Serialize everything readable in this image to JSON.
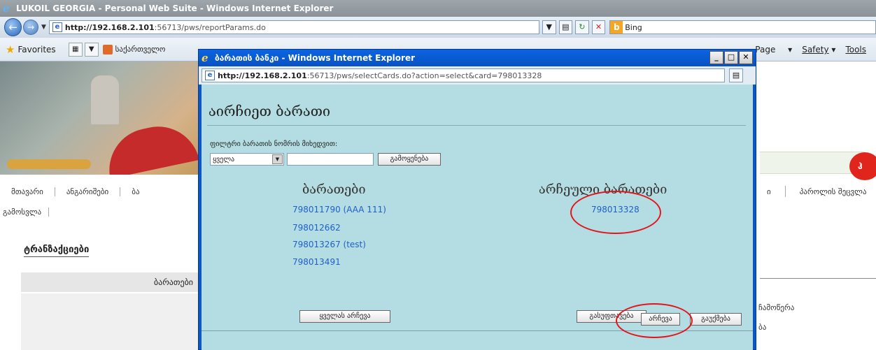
{
  "main_window": {
    "title": "LUKOIL GEORGIA - Personal Web Suite - Windows Internet Explorer",
    "url_host": "http://192.168.2.101",
    "url_rest": ":56713/pws/reportParams.do",
    "search_engine": "Bing",
    "favorites_label": "Favorites",
    "favorite_site": "საქართველო",
    "menu_page": "Page",
    "menu_safety": "Safety",
    "menu_tools": "Tools"
  },
  "page": {
    "nav_items": [
      "მთავარი",
      "ანგარიშები",
      "ბა"
    ],
    "nav_right_items": [
      "ი",
      "პაროლის შეცვლა"
    ],
    "logout": "გამოსვლა",
    "section_title": "ტრანზაქციები",
    "cards_column_header": "ბარათები",
    "right_text_1": "ჩამოწერა",
    "right_text_2": "ბა",
    "red_button_text": "ჰ"
  },
  "popup": {
    "title": "ბარათის ბანკი - Windows Internet Explorer",
    "url_host": "http://192.168.2.101",
    "url_rest": ":56713/pws/selectCards.do?action=select&card=798013328",
    "heading": "აირჩიეთ ბარათი",
    "filter_label": "ფილტრი ბარათის ნომრის მიხედვით:",
    "filter_select_value": "ყველა",
    "filter_input_value": "",
    "filter_button": "გამოყენება",
    "available_title": "ბარათები",
    "selected_title": "არჩეული ბარათები",
    "available_cards": [
      "798011790 (AAA 111)",
      "798012662",
      "798013267 (test)",
      "798013491"
    ],
    "selected_cards": [
      "798013328"
    ],
    "select_all_button": "ყველას არჩევა",
    "clear_button": "გასუფთავება",
    "ok_button": "არჩევა",
    "cancel_button": "გაუქმება"
  },
  "colors": {
    "popup_frame": "#0a57c5",
    "content_bg": "#b3dde2",
    "link": "#1f5fc9",
    "annotation": "#e3141b"
  }
}
